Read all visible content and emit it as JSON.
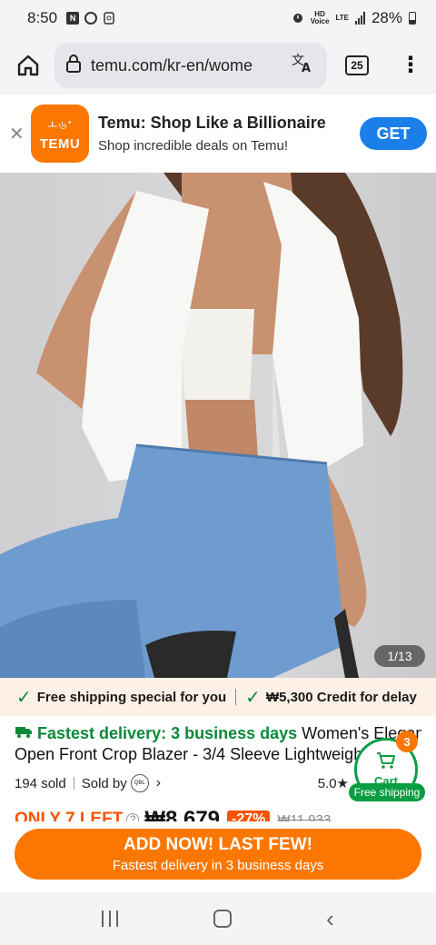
{
  "status_bar": {
    "time": "8:50",
    "left_icons": [
      "n-badge-icon",
      "aperture-icon",
      "file-icon"
    ],
    "hd_label": "HD",
    "voice_label": "Voice",
    "lte_label": "LTE",
    "battery": "28%"
  },
  "browser": {
    "url": "temu.com/kr-en/wome",
    "tab_count": "25"
  },
  "app_banner": {
    "logo_glyphs": "ㅗ৬ᐩ",
    "logo_text": "TEMU",
    "title": "Temu: Shop Like a Billionaire",
    "subtitle": "Shop incredible deals on Temu!",
    "get_label": "GET"
  },
  "gallery": {
    "counter": "1/13"
  },
  "promo": {
    "free_shipping": "Free shipping special for you",
    "credit": "₩5,300 Credit for delay"
  },
  "product": {
    "fastest": "Fastest delivery: 3 business days",
    "title_part1": "Women's Elegant",
    "title_line2": "Open Front Crop Blazer - 3/4 Sleeve Lightweight",
    "sold": "194 sold",
    "sold_by": "Sold by",
    "seller_badge": "QBL",
    "rating": "5.0",
    "stock": "ONLY 7 LEFT",
    "price": "₩8,679",
    "discount": "-27%",
    "original_price": "₩11,933"
  },
  "cart": {
    "count": "3",
    "label": "Cart",
    "free_shipping": "Free shipping"
  },
  "cta": {
    "main": "ADD NOW! LAST FEW!",
    "sub": "Fastest delivery in 3 business days"
  },
  "colors": {
    "brand_orange": "#fb7701",
    "green": "#0a9d43",
    "get_blue": "#1a7fe8"
  }
}
